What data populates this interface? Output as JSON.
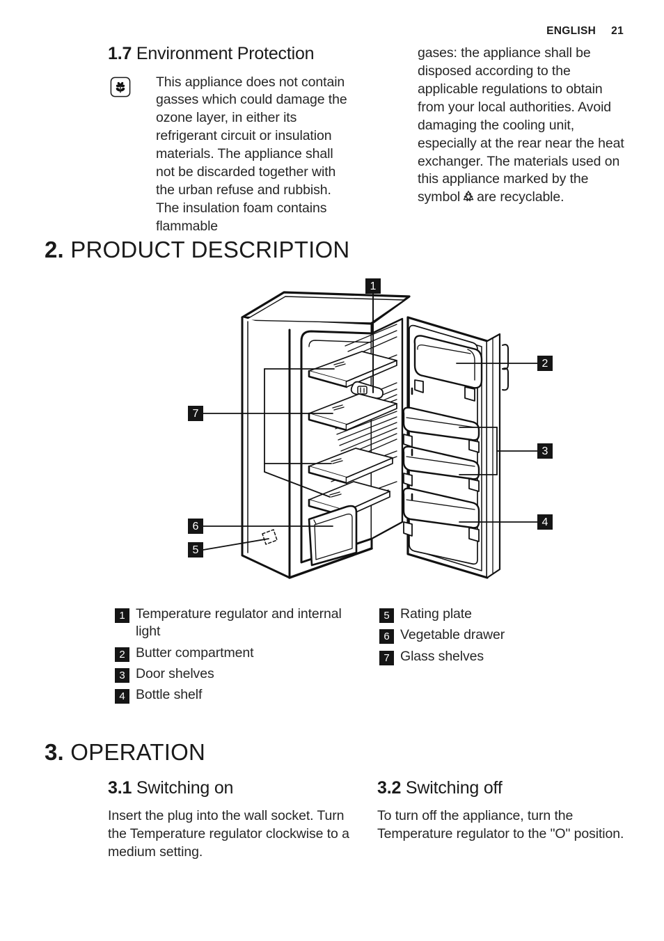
{
  "header": {
    "language": "ENGLISH",
    "page_number": "21"
  },
  "section_1_7": {
    "number": "1.7",
    "title": "Environment Protection",
    "icon": "flower-eco-icon",
    "left_text": "This appliance does not contain gasses which could damage the ozone layer, in either its refrigerant circuit or insulation materials. The appliance shall not be discarded together with the urban refuse and rubbish. The insulation foam contains flammable",
    "right_text_before_symbol": "gases: the appliance shall be disposed according to the applicable regulations to obtain from your local authorities. Avoid damaging the cooling unit, especially at the rear near the heat exchanger. The materials used on this appliance marked by the symbol",
    "right_symbol": "recycling-icon",
    "right_text_after_symbol": "are recyclable."
  },
  "chapter_2": {
    "number": "2.",
    "title": "PRODUCT DESCRIPTION"
  },
  "diagram": {
    "name": "refrigerator-cutaway-diagram",
    "callouts": [
      {
        "id": "1",
        "position": "top"
      },
      {
        "id": "2",
        "position": "right"
      },
      {
        "id": "3",
        "position": "right"
      },
      {
        "id": "4",
        "position": "right"
      },
      {
        "id": "5",
        "position": "left"
      },
      {
        "id": "6",
        "position": "left"
      },
      {
        "id": "7",
        "position": "left"
      }
    ]
  },
  "legend": {
    "left": [
      {
        "num": "1",
        "label": "Temperature regulator and internal light"
      },
      {
        "num": "2",
        "label": "Butter compartment"
      },
      {
        "num": "3",
        "label": "Door shelves"
      },
      {
        "num": "4",
        "label": "Bottle shelf"
      }
    ],
    "right": [
      {
        "num": "5",
        "label": "Rating plate"
      },
      {
        "num": "6",
        "label": "Vegetable drawer"
      },
      {
        "num": "7",
        "label": "Glass shelves"
      }
    ]
  },
  "chapter_3": {
    "number": "3.",
    "title": "OPERATION"
  },
  "section_3_1": {
    "number": "3.1",
    "title": "Switching on",
    "text": "Insert the plug into the wall socket. Turn the Temperature regulator clockwise to a medium setting."
  },
  "section_3_2": {
    "number": "3.2",
    "title": "Switching off",
    "text": "To turn off the appliance, turn the Temperature regulator to the \"O\" position."
  },
  "colors": {
    "ink": "#1a1a1a",
    "body": "#262626",
    "badge_bg": "#151515",
    "badge_fg": "#ffffff",
    "page_bg": "#ffffff"
  }
}
